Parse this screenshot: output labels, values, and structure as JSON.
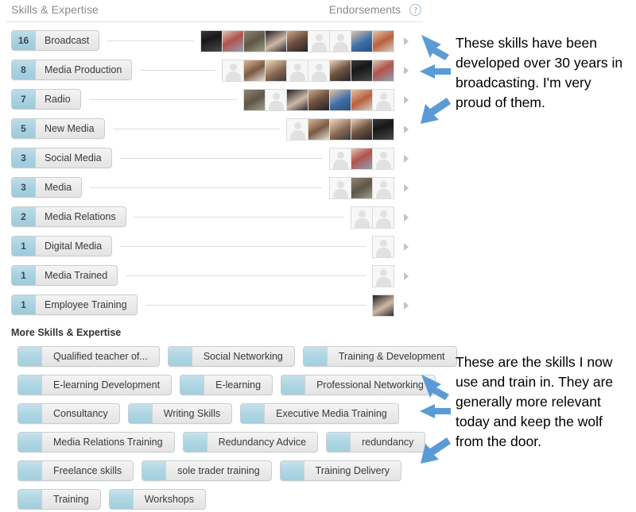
{
  "header": {
    "title": "Skills & Expertise",
    "endorsements_label": "Endorsements",
    "help_icon": "question-mark-icon",
    "help_glyph": "?"
  },
  "skills": [
    {
      "count": "16",
      "name": "Broadcast",
      "avatars": [
        "photo",
        "photo",
        "photo",
        "photo",
        "photo",
        "placeholder",
        "placeholder",
        "photo",
        "photo"
      ]
    },
    {
      "count": "8",
      "name": "Media Production",
      "avatars": [
        "placeholder",
        "photo",
        "photo",
        "placeholder",
        "placeholder",
        "photo",
        "photo",
        "photo"
      ]
    },
    {
      "count": "7",
      "name": "Radio",
      "avatars": [
        "photo",
        "placeholder",
        "photo",
        "photo",
        "photo",
        "photo",
        "placeholder"
      ]
    },
    {
      "count": "5",
      "name": "New Media",
      "avatars": [
        "placeholder",
        "photo",
        "photo",
        "photo",
        "photo"
      ]
    },
    {
      "count": "3",
      "name": "Social Media",
      "avatars": [
        "placeholder",
        "photo",
        "placeholder"
      ]
    },
    {
      "count": "3",
      "name": "Media",
      "avatars": [
        "placeholder",
        "photo",
        "placeholder"
      ]
    },
    {
      "count": "2",
      "name": "Media Relations",
      "avatars": [
        "placeholder",
        "placeholder"
      ]
    },
    {
      "count": "1",
      "name": "Digital Media",
      "avatars": [
        "placeholder"
      ]
    },
    {
      "count": "1",
      "name": "Media Trained",
      "avatars": [
        "placeholder"
      ]
    },
    {
      "count": "1",
      "name": "Employee Training",
      "avatars": [
        "photo"
      ]
    }
  ],
  "more_skills": {
    "title": "More Skills & Expertise",
    "rows": [
      [
        "Qualified teacher of...",
        "Social Networking",
        "Training & Development"
      ],
      [
        "E-learning Development",
        "E-learning",
        "Professional Networking"
      ],
      [
        "Consultancy",
        "Writing Skills",
        "Executive Media Training"
      ],
      [
        "Media Relations Training",
        "Redundancy Advice",
        "redundancy"
      ],
      [
        "Freelance skills",
        "sole trader training",
        "Training Delivery"
      ],
      [
        "Training",
        "Workshops"
      ]
    ]
  },
  "annotations": [
    {
      "id": "annotation-top",
      "text": "These skills have been developed over 30 years in broadcasting. I'm very proud of them.",
      "arrows": [
        "arrow-up-left-icon",
        "arrow-left-icon",
        "arrow-down-left-icon"
      ]
    },
    {
      "id": "annotation-bottom",
      "text": "These are the skills I now use and train in. They are generally more relevant today and keep the wolf from the door.",
      "arrows": [
        "arrow-up-left-icon",
        "arrow-left-icon",
        "arrow-down-left-icon"
      ]
    }
  ],
  "colors": {
    "accent_blue": "#a8d2e2",
    "arrow_blue": "#5b9bd5",
    "pill_grey": "#eaeaea",
    "header_text": "#8a8a8a",
    "body_text": "#3a3a3a"
  }
}
